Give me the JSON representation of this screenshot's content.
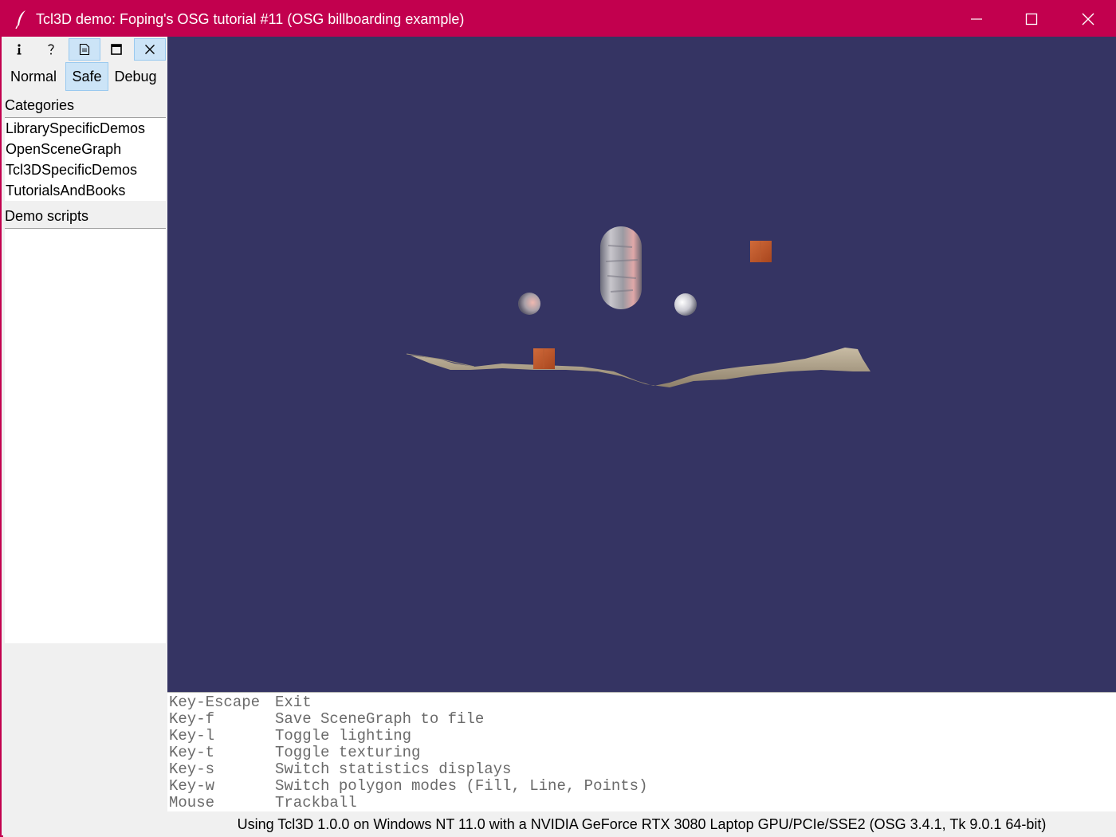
{
  "window": {
    "title": "Tcl3D demo: Foping's OSG tutorial #11 (OSG billboarding example)",
    "accent_color": "#c2004e",
    "controls": [
      "minimize-icon",
      "maximize-icon",
      "close-icon"
    ]
  },
  "toolbar": {
    "buttons": [
      {
        "icon": "info-icon",
        "glyph": "i"
      },
      {
        "icon": "help-icon",
        "glyph": "?"
      },
      {
        "icon": "document-icon",
        "active": true
      },
      {
        "icon": "window-icon"
      },
      {
        "icon": "close-icon",
        "active": true
      }
    ]
  },
  "modes": {
    "normal": "Normal",
    "safe": "Safe",
    "debug": "Debug",
    "selected": "Safe"
  },
  "categories": {
    "label": "Categories",
    "items": [
      "LibrarySpecificDemos",
      "OpenSceneGraph",
      "Tcl3DSpecificDemos",
      "TutorialsAndBooks"
    ]
  },
  "demo_scripts": {
    "label": "Demo scripts",
    "items": []
  },
  "viewport": {
    "background_color": "#353463"
  },
  "keyhelp": [
    {
      "key": "Key-Escape",
      "action": "Exit"
    },
    {
      "key": "Key-f",
      "action": "Save SceneGraph to file"
    },
    {
      "key": "Key-l",
      "action": "Toggle lighting"
    },
    {
      "key": "Key-t",
      "action": "Toggle texturing"
    },
    {
      "key": "Key-s",
      "action": "Switch statistics displays"
    },
    {
      "key": "Key-w",
      "action": "Switch polygon modes (Fill, Line, Points)"
    },
    {
      "key": "Mouse",
      "action": "Trackball"
    }
  ],
  "status": {
    "text": "Using Tcl3D 1.0.0 on Windows NT 11.0 with a NVIDIA GeForce RTX 3080 Laptop GPU/PCIe/SSE2 (OSG 3.4.1, Tk 9.0.1 64-bit)"
  }
}
